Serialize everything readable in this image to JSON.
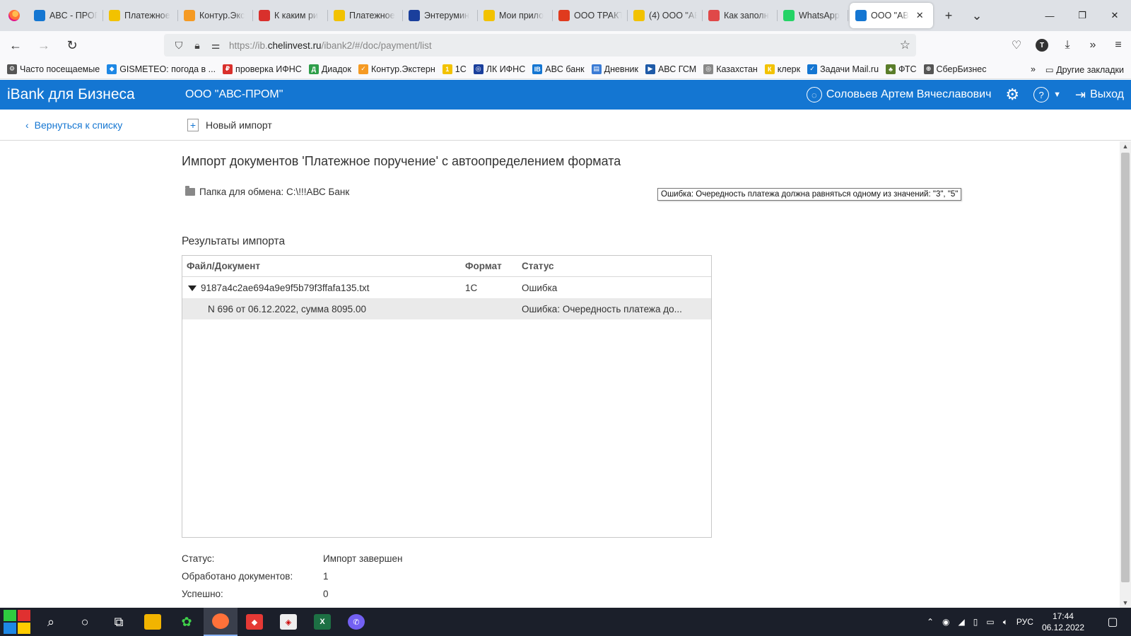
{
  "browser": {
    "tabs": [
      {
        "label": "ABC - ПРОГ",
        "icon": "mail-icon",
        "color": "#1476d2"
      },
      {
        "label": "Платежное",
        "icon": "coin-icon",
        "color": "#f2c200"
      },
      {
        "label": "Контур.Экс",
        "icon": "kontur-icon",
        "color": "#f59a23"
      },
      {
        "label": "К каким ри",
        "icon": "nalog-icon",
        "color": "#d9302c"
      },
      {
        "label": "Платежное",
        "icon": "clip-icon",
        "color": "#f2c200"
      },
      {
        "label": "Энтерумин",
        "icon": "cross-icon",
        "color": "#1a3f9c"
      },
      {
        "label": "Мои прило",
        "icon": "1c-icon",
        "color": "#f2c200"
      },
      {
        "label": "ООО ТРАКТ",
        "icon": "1c-icon",
        "color": "#e03a1e"
      },
      {
        "label": "(4) ООО \"АЕ",
        "icon": "1c-icon",
        "color": "#f2c200"
      },
      {
        "label": "Как заполн",
        "icon": "pin-icon",
        "color": "#e04848"
      },
      {
        "label": "WhatsApp",
        "icon": "whatsapp-icon",
        "color": "#25d366"
      },
      {
        "label": "ООО \"АВ",
        "icon": "ibank-icon",
        "color": "#1476d2",
        "active": true
      }
    ],
    "new_tab": "+",
    "tab_list": "⌄",
    "url_prefix": "https://ib.",
    "url_domain": "chelinvest.ru",
    "url_path": "/ibank2/#/doc/payment/list",
    "profile_letter": "T"
  },
  "bookmarks": [
    {
      "label": "Часто посещаемые",
      "color": "#555",
      "glyph": "⚙"
    },
    {
      "label": "GISMETEO: погода в ...",
      "color": "#1e88e5",
      "glyph": "◆"
    },
    {
      "label": "проверка ИФНС",
      "color": "#d9302c",
      "glyph": "₽"
    },
    {
      "label": "Диадок",
      "color": "#2e9e4a",
      "glyph": "Д"
    },
    {
      "label": "Контур.Экстерн",
      "color": "#f59a23",
      "glyph": "✓"
    },
    {
      "label": "1С",
      "color": "#f2c200",
      "glyph": "1"
    },
    {
      "label": "ЛК ИФНС",
      "color": "#1a3f9c",
      "glyph": "◎"
    },
    {
      "label": "ABC банк",
      "color": "#1476d2",
      "glyph": "IB"
    },
    {
      "label": "Дневник",
      "color": "#3a7bd5",
      "glyph": "▤"
    },
    {
      "label": "АВС ГСМ",
      "color": "#1e5aa8",
      "glyph": "▶"
    },
    {
      "label": "Казахстан",
      "color": "#888",
      "glyph": "◎"
    },
    {
      "label": "клерк",
      "color": "#f2c200",
      "glyph": "К"
    },
    {
      "label": "Задачи Mail.ru",
      "color": "#1476d2",
      "glyph": "✓"
    },
    {
      "label": "ФТС",
      "color": "#5a7d2a",
      "glyph": "♣"
    },
    {
      "label": "СберБизнес",
      "color": "#555",
      "glyph": "⊕"
    }
  ],
  "bookmarks_more": "»",
  "bookmarks_other": "Другие закладки",
  "app": {
    "brand": "iBank для Бизнеса",
    "org": "ООО \"АВС-ПРОМ\"",
    "user": "Соловьев Артем Вячеславович",
    "logout": "Выход"
  },
  "toolbar": {
    "back": "Вернуться к списку",
    "new_import": "Новый импорт"
  },
  "page": {
    "title": "Импорт документов 'Платежное поручение' с автоопределением формата",
    "folder": "Папка для обмена: C:\\!!!АВС Банк",
    "results_title": "Результаты импорта"
  },
  "grid": {
    "headers": [
      "Файл/Документ",
      "Формат",
      "Статус"
    ],
    "file_row": {
      "name": "9187a4c2ae694a9e9f5b79f3ffafa135.txt",
      "format": "1C",
      "status": "Ошибка"
    },
    "doc_row": {
      "name": "N 696 от 06.12.2022, сумма 8095.00",
      "format": "",
      "status": "Ошибка: Очередность платежа до..."
    }
  },
  "tooltip": "Ошибка: Очередность платежа должна равняться одному из значений: \"3\", \"5\"",
  "stats": {
    "status_label": "Статус:",
    "status_value": "Импорт завершен",
    "processed_label": "Обработано документов:",
    "processed_value": "1",
    "success_label": "Успешно:",
    "success_value": "0"
  },
  "taskbar": {
    "lang": "РУС",
    "time": "17:44",
    "date": "06.12.2022"
  }
}
